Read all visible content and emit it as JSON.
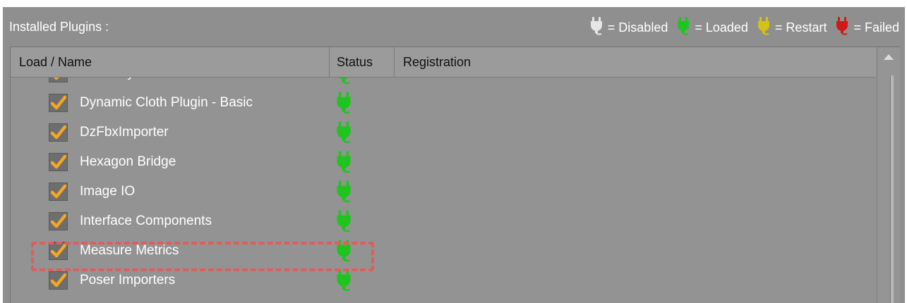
{
  "topbar": {
    "title": "Installed Plugins :"
  },
  "legend": [
    {
      "icon": "plug-disabled-icon",
      "color": "#e6e6e6",
      "label": "= Disabled"
    },
    {
      "icon": "plug-loaded-icon",
      "color": "#1fc41f",
      "label": "= Loaded"
    },
    {
      "icon": "plug-restart-icon",
      "color": "#d4c21a",
      "label": "= Restart"
    },
    {
      "icon": "plug-failed-icon",
      "color": "#d41818",
      "label": "= Failed"
    }
  ],
  "table": {
    "headers": [
      "Load / Name",
      "Status",
      "Registration"
    ],
    "rows": [
      {
        "name": "Draw Styles",
        "checked": true,
        "status": "Loaded",
        "registration": ""
      },
      {
        "name": "Dynamic Cloth Plugin - Basic",
        "checked": true,
        "status": "Loaded",
        "registration": ""
      },
      {
        "name": "DzFbxImporter",
        "checked": true,
        "status": "Loaded",
        "registration": ""
      },
      {
        "name": "Hexagon Bridge",
        "checked": true,
        "status": "Loaded",
        "registration": ""
      },
      {
        "name": "Image IO",
        "checked": true,
        "status": "Loaded",
        "registration": ""
      },
      {
        "name": "Interface Components",
        "checked": true,
        "status": "Loaded",
        "registration": ""
      },
      {
        "name": "Measure Metrics",
        "checked": true,
        "status": "Loaded",
        "registration": "",
        "highlighted": true
      },
      {
        "name": "Poser Importers",
        "checked": true,
        "status": "Loaded",
        "registration": ""
      }
    ]
  },
  "colors": {
    "panel": "#8f8f8f",
    "checkmark": "#f5a623",
    "loaded": "#1fc41f",
    "highlight": "#e65a5a"
  }
}
